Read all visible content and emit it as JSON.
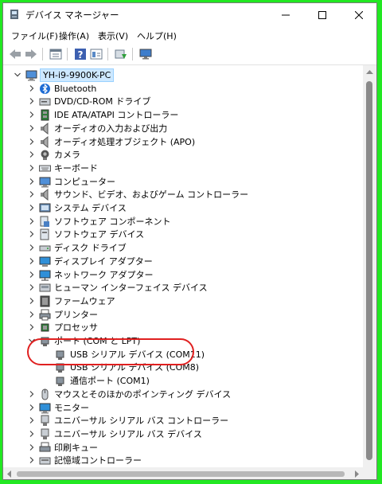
{
  "window": {
    "title": "デバイス マネージャー"
  },
  "menu": [
    "ファイル(F)",
    "操作(A)",
    "表示(V)",
    "ヘルプ(H)"
  ],
  "toolbar": [
    "back-icon",
    "forward-icon",
    "properties-icon",
    "help-icon",
    "view-icon",
    "update-driver-icon",
    "monitor-icon"
  ],
  "tree": {
    "root": "YH-i9-9900K-PC",
    "items": [
      {
        "label": "Bluetooth",
        "icon": "bluetooth-icon",
        "expanded": false
      },
      {
        "label": "DVD/CD-ROM ドライブ",
        "icon": "dvd-icon",
        "expanded": false
      },
      {
        "label": "IDE ATA/ATAPI コントローラー",
        "icon": "ide-controller-icon",
        "expanded": false
      },
      {
        "label": "オーディオの入力および出力",
        "icon": "audio-io-icon",
        "expanded": false
      },
      {
        "label": "オーディオ処理オブジェクト (APO)",
        "icon": "audio-apo-icon",
        "expanded": false
      },
      {
        "label": "カメラ",
        "icon": "camera-icon",
        "expanded": false
      },
      {
        "label": "キーボード",
        "icon": "keyboard-icon",
        "expanded": false
      },
      {
        "label": "コンピューター",
        "icon": "computer-icon",
        "expanded": false
      },
      {
        "label": "サウンド、ビデオ、およびゲーム コントローラー",
        "icon": "sound-icon",
        "expanded": false
      },
      {
        "label": "システム デバイス",
        "icon": "system-device-icon",
        "expanded": false
      },
      {
        "label": "ソフトウェア コンポーネント",
        "icon": "software-component-icon",
        "expanded": false
      },
      {
        "label": "ソフトウェア デバイス",
        "icon": "software-device-icon",
        "expanded": false
      },
      {
        "label": "ディスク ドライブ",
        "icon": "disk-drive-icon",
        "expanded": false
      },
      {
        "label": "ディスプレイ アダプター",
        "icon": "display-adapter-icon",
        "expanded": false
      },
      {
        "label": "ネットワーク アダプター",
        "icon": "network-adapter-icon",
        "expanded": false
      },
      {
        "label": "ヒューマン インターフェイス デバイス",
        "icon": "hid-icon",
        "expanded": false
      },
      {
        "label": "ファームウェア",
        "icon": "firmware-icon",
        "expanded": false
      },
      {
        "label": "プリンター",
        "icon": "printer-icon",
        "expanded": false
      },
      {
        "label": "プロセッサ",
        "icon": "processor-icon",
        "expanded": false
      },
      {
        "label": "ポート (COM と LPT)",
        "icon": "port-icon",
        "expanded": true,
        "children": [
          {
            "label": "USB シリアル デバイス (COM11)",
            "icon": "port-device-icon"
          },
          {
            "label": "USB シリアル デバイス (COM8)",
            "icon": "port-device-icon"
          },
          {
            "label": "通信ポート (COM1)",
            "icon": "port-device-icon"
          }
        ]
      },
      {
        "label": "マウスとそのほかのポインティング デバイス",
        "icon": "mouse-icon",
        "expanded": false
      },
      {
        "label": "モニター",
        "icon": "monitor-icon",
        "expanded": false
      },
      {
        "label": "ユニバーサル シリアル バス コントローラー",
        "icon": "usb-controller-icon",
        "expanded": false
      },
      {
        "label": "ユニバーサル シリアル バス デバイス",
        "icon": "usb-device-icon",
        "expanded": false
      },
      {
        "label": "印刷キュー",
        "icon": "print-queue-icon",
        "expanded": false
      },
      {
        "label": "記憶域コントローラー",
        "icon": "storage-controller-icon",
        "expanded": false
      }
    ]
  },
  "colors": {
    "frame": "#22e822",
    "selection": "#cde8ff",
    "highlight": "#e02020"
  }
}
